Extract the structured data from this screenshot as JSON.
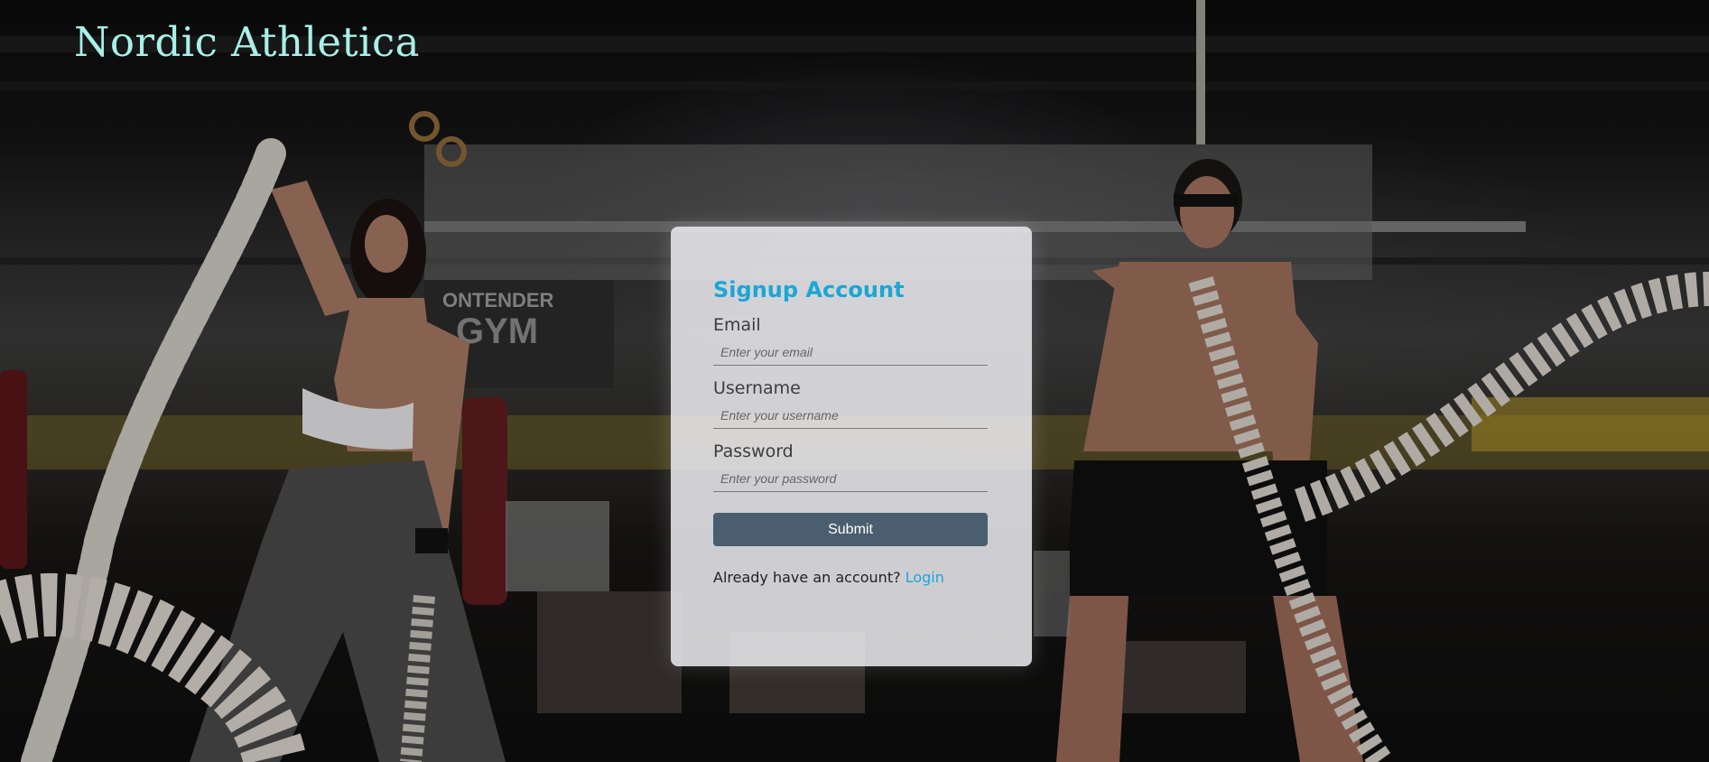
{
  "brand": {
    "name": "Nordic Athletica",
    "color": "#a8f0e8"
  },
  "form": {
    "title": "Signup Account",
    "email": {
      "label": "Email",
      "placeholder": "Enter your email",
      "value": ""
    },
    "username": {
      "label": "Username",
      "placeholder": "Enter your username",
      "value": ""
    },
    "password": {
      "label": "Password",
      "placeholder": "Enter your password",
      "value": ""
    },
    "submit_label": "Submit",
    "login_prompt": "Already have an account?",
    "login_link": "Login"
  },
  "colors": {
    "accent": "#1ba6d6",
    "button": "#4a5e70",
    "card": "#eeeef2"
  },
  "background": {
    "description_icon": "gym-photo-battle-ropes"
  }
}
